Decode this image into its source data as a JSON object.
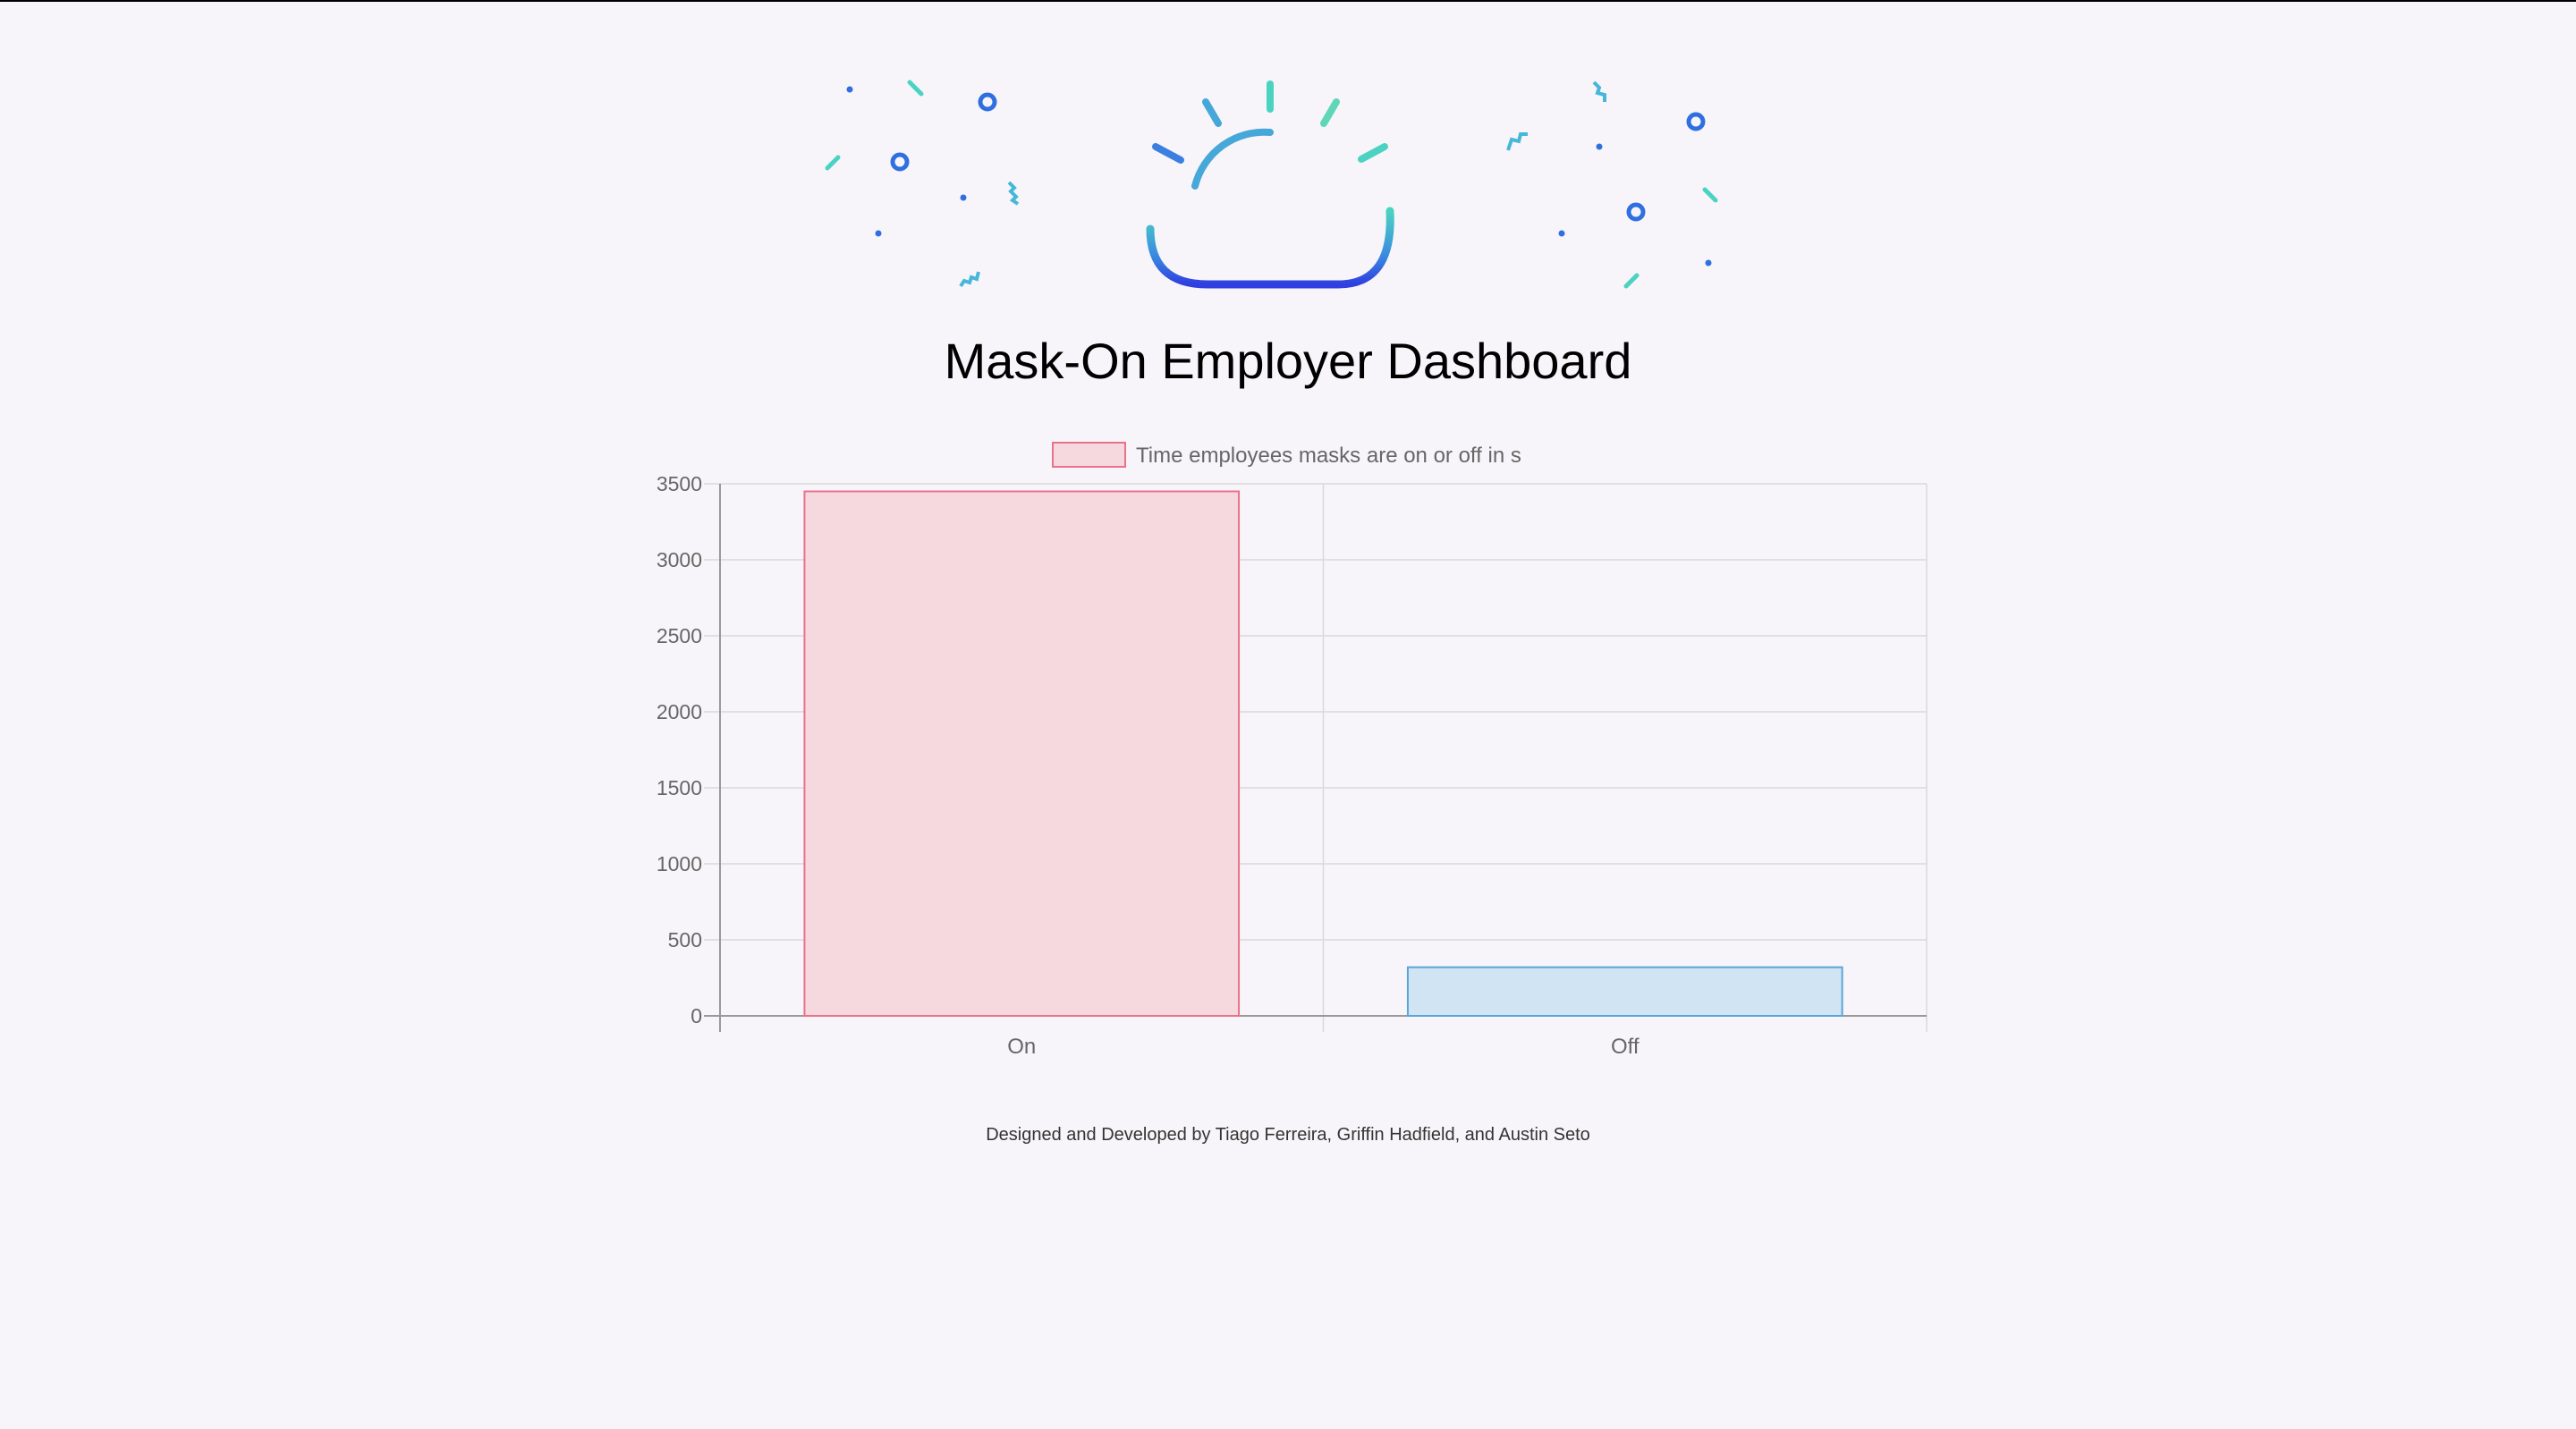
{
  "page": {
    "title": "Mask-On Employer Dashboard",
    "footer": "Designed and Developed by Tiago Ferreira, Griffin Hadfield, and Austin Seto"
  },
  "hero": {
    "icon": "cloud-with-rays-icon",
    "accent_colors": [
      "#2f5fdc",
      "#4bd3c2",
      "#3b8be0"
    ]
  },
  "chart_data": {
    "type": "bar",
    "categories": [
      "On",
      "Off"
    ],
    "series": [
      {
        "name": "Time employees masks are on or off in s",
        "values": [
          3450,
          320
        ]
      }
    ],
    "bar_colors": [
      {
        "fill": "#f6d9df",
        "stroke": "#e8728b"
      },
      {
        "fill": "#d0e4f4",
        "stroke": "#5aa6d6"
      }
    ],
    "ylim": [
      0,
      3500
    ],
    "yticks": [
      0,
      500,
      1000,
      1500,
      2000,
      2500,
      3000,
      3500
    ],
    "ytick_labels": [
      "0",
      "500",
      "1000",
      "1500",
      "2000",
      "2500",
      "3000",
      "3500"
    ],
    "grid": true,
    "legend_position": "top-center"
  }
}
